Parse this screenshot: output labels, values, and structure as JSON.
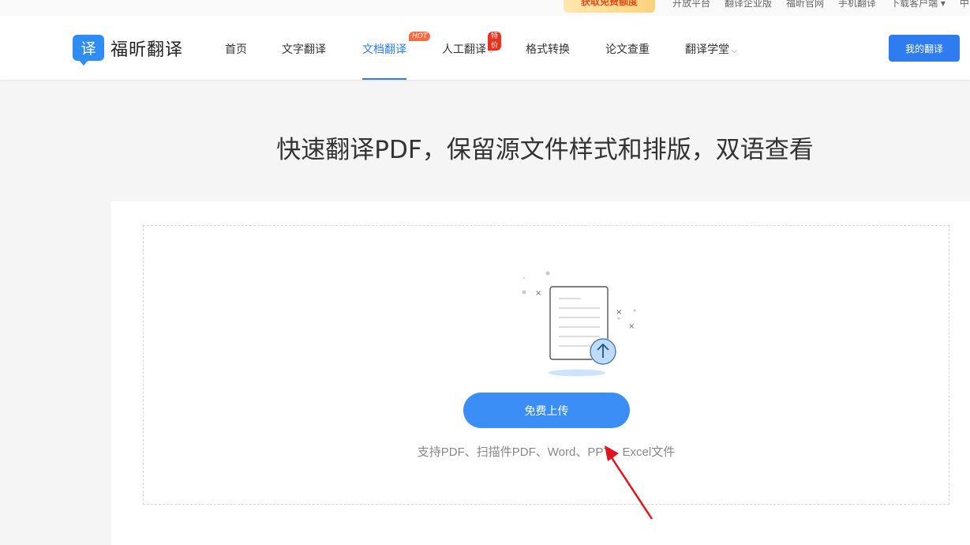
{
  "topbar": {
    "promo": "获取免费额度",
    "links": [
      "开放平台",
      "翻译企业版",
      "福昕官网",
      "手机翻译",
      "下载客户端 ▾",
      "中"
    ]
  },
  "header": {
    "logo_glyph": "译",
    "logo_text": "福昕翻译",
    "nav": [
      {
        "label": "首页"
      },
      {
        "label": "文字翻译"
      },
      {
        "label": "文档翻译",
        "badge": "HOT",
        "active": true
      },
      {
        "label": "人工翻译",
        "badge": "特价",
        "dropdown": true
      },
      {
        "label": "格式转换"
      },
      {
        "label": "论文查重"
      },
      {
        "label": "翻译学堂",
        "dropdown": true
      }
    ],
    "my_translation": "我的翻译"
  },
  "hero": {
    "title": "快速翻译PDF，保留源文件样式和排版，双语查看"
  },
  "upload": {
    "button": "免费上传",
    "supported": "支持PDF、扫描件PDF、Word、PPT、Excel文件"
  },
  "colors": {
    "accent": "#2f7cf0",
    "hot_badge": "#ff6a3d",
    "sale_badge": "#e8341f",
    "annotation_arrow": "#e0141e"
  },
  "icons": [
    "caret-down-icon",
    "document-upload-icon",
    "upload-arrow-icon",
    "red-annotation-arrow"
  ]
}
